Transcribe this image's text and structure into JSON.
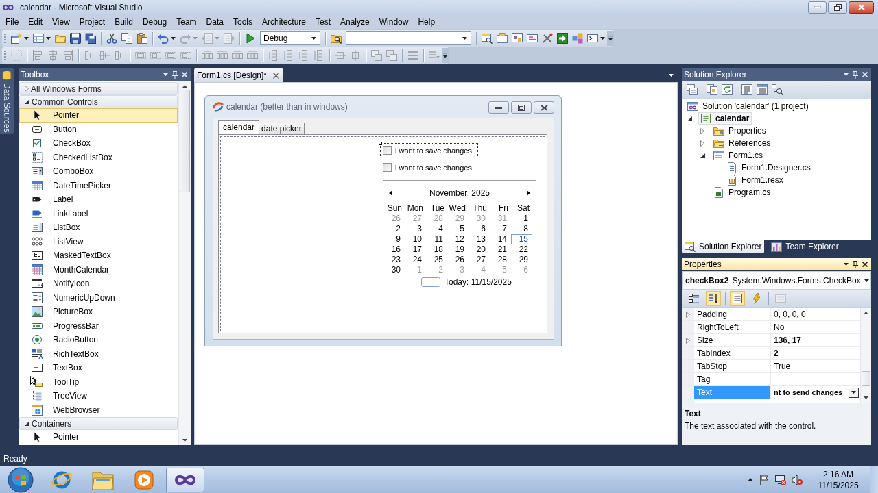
{
  "window": {
    "title": "calendar - Microsoft Visual Studio"
  },
  "menu": [
    "File",
    "Edit",
    "View",
    "Project",
    "Build",
    "Debug",
    "Team",
    "Data",
    "Tools",
    "Architecture",
    "Test",
    "Analyze",
    "Window",
    "Help"
  ],
  "standard_toolbar": [
    {
      "kind": "newproject",
      "disabled": false,
      "dropdown": true
    },
    {
      "kind": "additem",
      "disabled": false,
      "dropdown": true
    },
    {
      "kind": "open",
      "disabled": false,
      "dropdown": false
    },
    {
      "kind": "save",
      "disabled": false,
      "dropdown": false
    },
    {
      "kind": "saveall",
      "disabled": false,
      "dropdown": false
    },
    {
      "kind": "separator"
    },
    {
      "kind": "cut",
      "disabled": false,
      "dropdown": false
    },
    {
      "kind": "copy",
      "disabled": false,
      "dropdown": false
    },
    {
      "kind": "paste",
      "disabled": false,
      "dropdown": false
    },
    {
      "kind": "separator"
    },
    {
      "kind": "undo",
      "disabled": false,
      "dropdown": true
    },
    {
      "kind": "redo",
      "disabled": true,
      "dropdown": true
    },
    {
      "kind": "navback",
      "disabled": true,
      "dropdown": true
    },
    {
      "kind": "navforward",
      "disabled": true,
      "dropdown": false
    },
    {
      "kind": "separator"
    },
    {
      "kind": "start",
      "disabled": false,
      "dropdown": false
    },
    {
      "kind": "combo",
      "value": "Debug"
    },
    {
      "kind": "separator"
    },
    {
      "kind": "findinfiles",
      "disabled": false,
      "dropdown": false
    },
    {
      "kind": "findcombo"
    },
    {
      "kind": "separator"
    },
    {
      "kind": "solutionexplorer",
      "disabled": false,
      "dropdown": false
    },
    {
      "kind": "properties",
      "disabled": false,
      "dropdown": false
    },
    {
      "kind": "objectbrowser",
      "disabled": false,
      "dropdown": false
    },
    {
      "kind": "toolbox",
      "disabled": false,
      "dropdown": false
    },
    {
      "kind": "tools",
      "disabled": false,
      "dropdown": false
    },
    {
      "kind": "startpage",
      "disabled": false,
      "dropdown": false
    },
    {
      "kind": "extension",
      "disabled": false,
      "dropdown": false
    },
    {
      "kind": "command",
      "disabled": false,
      "dropdown": true
    }
  ],
  "layout_toolbar": {
    "disabled": true
  },
  "side_tabs": [
    {
      "label": "Data Sources"
    }
  ],
  "toolbox": {
    "title": "Toolbox",
    "active": false,
    "groups": [
      {
        "label": "All Windows Forms",
        "expanded": false
      },
      {
        "label": "Common Controls",
        "expanded": true,
        "items": [
          {
            "label": "Pointer",
            "kind": "pointer",
            "selected": true
          },
          {
            "label": "Button",
            "kind": "button",
            "selected": false
          },
          {
            "label": "CheckBox",
            "kind": "checkbox",
            "selected": false
          },
          {
            "label": "CheckedListBox",
            "kind": "checkedlistbox",
            "selected": false
          },
          {
            "label": "ComboBox",
            "kind": "combobox",
            "selected": false
          },
          {
            "label": "DateTimePicker",
            "kind": "datetimepicker",
            "selected": false
          },
          {
            "label": "Label",
            "kind": "label",
            "selected": false
          },
          {
            "label": "LinkLabel",
            "kind": "linklabel",
            "selected": false
          },
          {
            "label": "ListBox",
            "kind": "listbox",
            "selected": false
          },
          {
            "label": "ListView",
            "kind": "listview",
            "selected": false
          },
          {
            "label": "MaskedTextBox",
            "kind": "maskedtextbox",
            "selected": false
          },
          {
            "label": "MonthCalendar",
            "kind": "monthcalendar",
            "selected": false
          },
          {
            "label": "NotifyIcon",
            "kind": "notifyicon",
            "selected": false
          },
          {
            "label": "NumericUpDown",
            "kind": "numericupdown",
            "selected": false
          },
          {
            "label": "PictureBox",
            "kind": "picturebox",
            "selected": false
          },
          {
            "label": "ProgressBar",
            "kind": "progressbar",
            "selected": false
          },
          {
            "label": "RadioButton",
            "kind": "radiobutton",
            "selected": false
          },
          {
            "label": "RichTextBox",
            "kind": "richtextbox",
            "selected": false
          },
          {
            "label": "TextBox",
            "kind": "textbox",
            "selected": false
          },
          {
            "label": "ToolTip",
            "kind": "tooltip",
            "selected": false
          },
          {
            "label": "TreeView",
            "kind": "treeview",
            "selected": false
          },
          {
            "label": "WebBrowser",
            "kind": "webbrowser",
            "selected": false
          }
        ]
      },
      {
        "label": "Containers",
        "expanded": true,
        "items": [
          {
            "label": "Pointer",
            "kind": "pointer",
            "selected": false
          }
        ]
      }
    ]
  },
  "document_tabs": [
    {
      "label": "Form1.cs [Design]*",
      "selected": true
    }
  ],
  "designer": {
    "form": {
      "title": "calendar (better than in windows)",
      "tabs": [
        {
          "label": "calendar",
          "selected": true
        },
        {
          "label": "date picker",
          "selected": false
        }
      ],
      "checkboxes": [
        {
          "label": "i want to save changes",
          "checked": false,
          "selected": true
        },
        {
          "label": "i want to save changes",
          "checked": false,
          "selected": false
        }
      ],
      "month_calendar": {
        "month": "November, 2025",
        "weekdays": [
          "Sun",
          "Mon",
          "Tue",
          "Wed",
          "Thu",
          "Fri",
          "Sat"
        ],
        "weeks": [
          [
            {
              "day": "26",
              "in_month": false,
              "selected": false
            },
            {
              "day": "27",
              "in_month": false,
              "selected": false
            },
            {
              "day": "28",
              "in_month": false,
              "selected": false
            },
            {
              "day": "29",
              "in_month": false,
              "selected": false
            },
            {
              "day": "30",
              "in_month": false,
              "selected": false
            },
            {
              "day": "31",
              "in_month": false,
              "selected": false
            },
            {
              "day": "1",
              "in_month": true,
              "selected": false
            }
          ],
          [
            {
              "day": "2",
              "in_month": true,
              "selected": false
            },
            {
              "day": "3",
              "in_month": true,
              "selected": false
            },
            {
              "day": "4",
              "in_month": true,
              "selected": false
            },
            {
              "day": "5",
              "in_month": true,
              "selected": false
            },
            {
              "day": "6",
              "in_month": true,
              "selected": false
            },
            {
              "day": "7",
              "in_month": true,
              "selected": false
            },
            {
              "day": "8",
              "in_month": true,
              "selected": false
            }
          ],
          [
            {
              "day": "9",
              "in_month": true,
              "selected": false
            },
            {
              "day": "10",
              "in_month": true,
              "selected": false
            },
            {
              "day": "11",
              "in_month": true,
              "selected": false
            },
            {
              "day": "12",
              "in_month": true,
              "selected": false
            },
            {
              "day": "13",
              "in_month": true,
              "selected": false
            },
            {
              "day": "14",
              "in_month": true,
              "selected": false
            },
            {
              "day": "15",
              "in_month": true,
              "selected": true
            }
          ],
          [
            {
              "day": "16",
              "in_month": true,
              "selected": false
            },
            {
              "day": "17",
              "in_month": true,
              "selected": false
            },
            {
              "day": "18",
              "in_month": true,
              "selected": false
            },
            {
              "day": "19",
              "in_month": true,
              "selected": false
            },
            {
              "day": "20",
              "in_month": true,
              "selected": false
            },
            {
              "day": "21",
              "in_month": true,
              "selected": false
            },
            {
              "day": "22",
              "in_month": true,
              "selected": false
            }
          ],
          [
            {
              "day": "23",
              "in_month": true,
              "selected": false
            },
            {
              "day": "24",
              "in_month": true,
              "selected": false
            },
            {
              "day": "25",
              "in_month": true,
              "selected": false
            },
            {
              "day": "26",
              "in_month": true,
              "selected": false
            },
            {
              "day": "27",
              "in_month": true,
              "selected": false
            },
            {
              "day": "28",
              "in_month": true,
              "selected": false
            },
            {
              "day": "29",
              "in_month": true,
              "selected": false
            }
          ],
          [
            {
              "day": "30",
              "in_month": true,
              "selected": false
            },
            {
              "day": "1",
              "in_month": false,
              "selected": false
            },
            {
              "day": "2",
              "in_month": false,
              "selected": false
            },
            {
              "day": "3",
              "in_month": false,
              "selected": false
            },
            {
              "day": "4",
              "in_month": false,
              "selected": false
            },
            {
              "day": "5",
              "in_month": false,
              "selected": false
            },
            {
              "day": "6",
              "in_month": false,
              "selected": false
            }
          ]
        ],
        "today": "Today: 11/15/2025"
      }
    }
  },
  "solution_explorer": {
    "title": "Solution Explorer",
    "active": false,
    "tree": [
      {
        "label": "Solution 'calendar' (1 project)",
        "kind": "solution",
        "selected": false,
        "children": [
          {
            "label": "calendar",
            "kind": "project",
            "expanded": true,
            "selected": true,
            "children": [
              {
                "label": "Properties",
                "kind": "properties",
                "expanded": false,
                "selected": false
              },
              {
                "label": "References",
                "kind": "references",
                "expanded": false,
                "selected": false
              },
              {
                "label": "Form1.cs",
                "kind": "form",
                "expanded": true,
                "selected": false,
                "children": [
                  {
                    "label": "Form1.Designer.cs",
                    "kind": "designer",
                    "selected": false
                  },
                  {
                    "label": "Form1.resx",
                    "kind": "resx",
                    "selected": false
                  }
                ]
              },
              {
                "label": "Program.cs",
                "kind": "code",
                "selected": false
              }
            ]
          }
        ]
      }
    ],
    "tabs": [
      {
        "label": "Solution Explorer",
        "kind": "solution",
        "selected": true
      },
      {
        "label": "Team Explorer",
        "kind": "team",
        "selected": false
      }
    ]
  },
  "properties": {
    "title": "Properties",
    "active": true,
    "object_name": "checkBox2",
    "object_type": "System.Windows.Forms.CheckBox",
    "toolbar": [
      {
        "kind": "categorized",
        "pressed": false,
        "disabled": false
      },
      {
        "kind": "alphabetical",
        "pressed": true,
        "disabled": false
      },
      {
        "kind": "separator"
      },
      {
        "kind": "properties",
        "pressed": true,
        "disabled": false
      },
      {
        "kind": "events",
        "pressed": false,
        "disabled": false
      },
      {
        "kind": "separator"
      },
      {
        "kind": "pages",
        "pressed": false,
        "disabled": true
      }
    ],
    "rows": [
      {
        "name": "Padding",
        "value": "0, 0, 0, 0",
        "expandable": true,
        "modified": false,
        "selected": false
      },
      {
        "name": "RightToLeft",
        "value": "No",
        "expandable": false,
        "modified": false,
        "selected": false
      },
      {
        "name": "Size",
        "value": "136, 17",
        "expandable": true,
        "modified": true,
        "selected": false
      },
      {
        "name": "TabIndex",
        "value": "2",
        "expandable": false,
        "modified": true,
        "selected": false
      },
      {
        "name": "TabStop",
        "value": "True",
        "expandable": false,
        "modified": false,
        "selected": false
      },
      {
        "name": "Tag",
        "expandable": false,
        "selected": false
      },
      {
        "name": "Text",
        "value": "nt to send changes",
        "expandable": false,
        "modified": true,
        "selected": true
      }
    ],
    "description": {
      "title": "Text",
      "text": "The text associated with the control."
    }
  },
  "status_bar": {
    "text": "Ready"
  },
  "taskbar": {
    "apps": [
      {
        "kind": "browser",
        "active": false
      },
      {
        "kind": "files",
        "active": false
      },
      {
        "kind": "media",
        "active": false
      },
      {
        "kind": "studio",
        "active": true
      }
    ],
    "tray": {
      "network_error": true,
      "volume_muted": true
    },
    "clock": {
      "time": "2:16 AM",
      "date": "11/15/2025"
    }
  }
}
